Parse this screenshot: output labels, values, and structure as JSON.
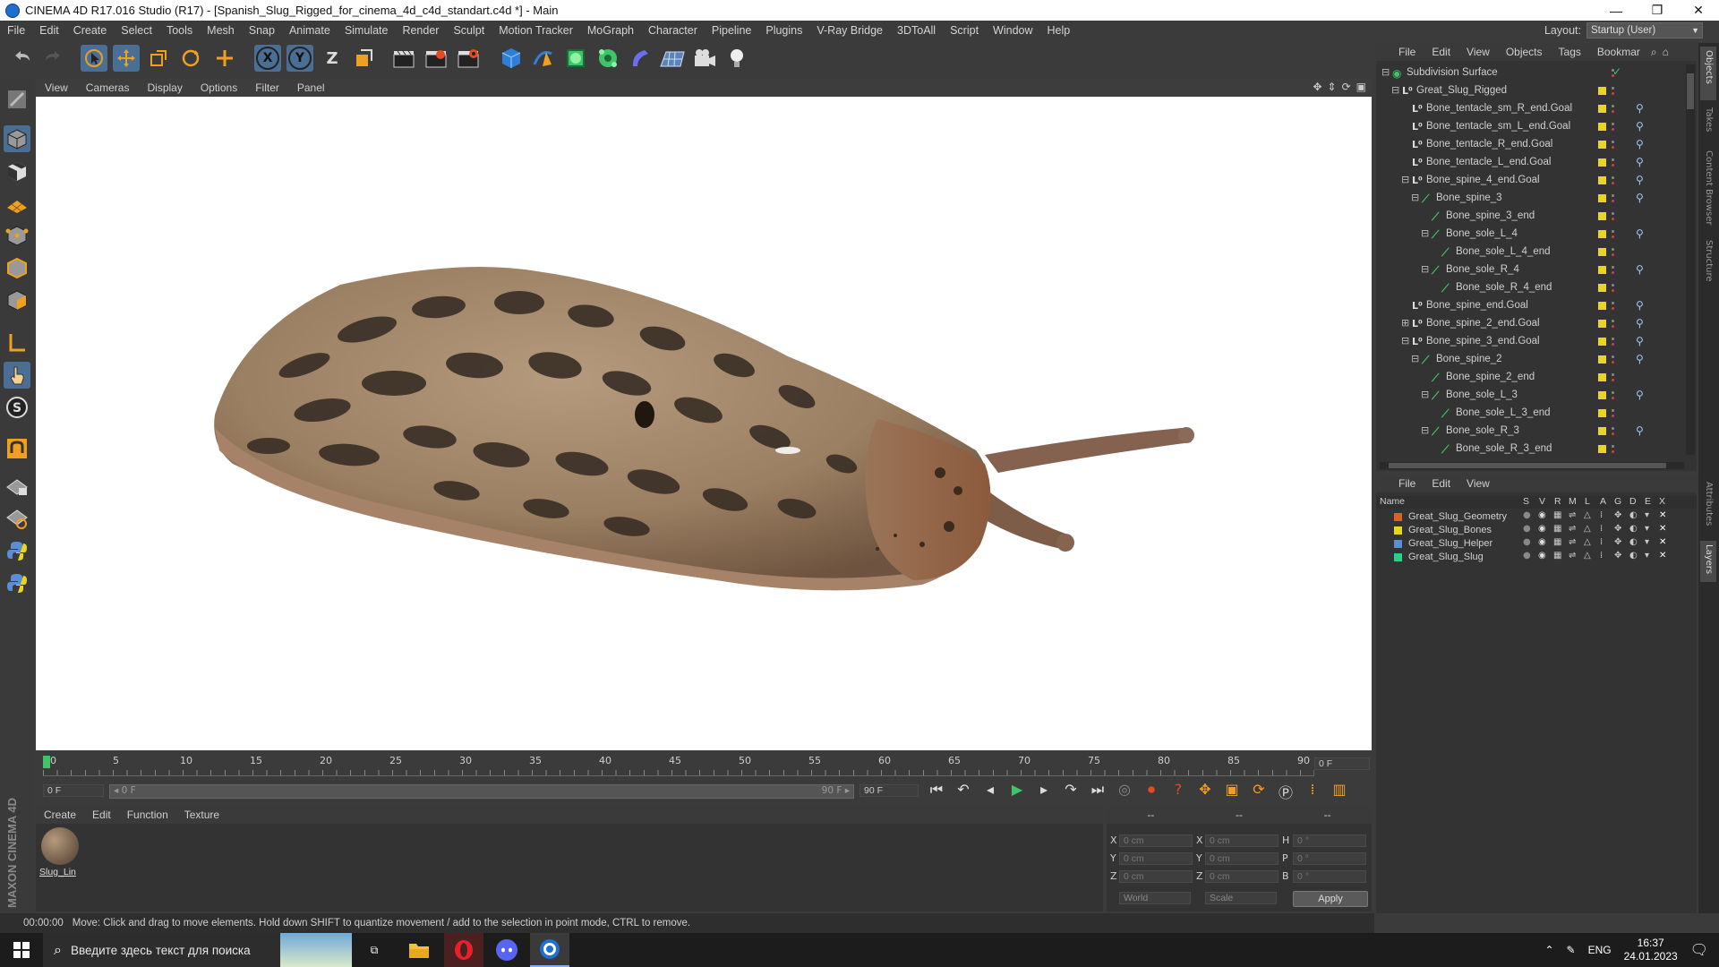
{
  "window": {
    "title": "CINEMA 4D R17.016 Studio (R17) - [Spanish_Slug_Rigged_for_cinema_4d_c4d_standart.c4d *] - Main",
    "minimize": "—",
    "maximize": "❐",
    "close": "✕"
  },
  "menu": {
    "items": [
      "File",
      "Edit",
      "Create",
      "Select",
      "Tools",
      "Mesh",
      "Snap",
      "Animate",
      "Simulate",
      "Render",
      "Sculpt",
      "Motion Tracker",
      "MoGraph",
      "Character",
      "Pipeline",
      "Plugins",
      "V-Ray Bridge",
      "3DToAll",
      "Script",
      "Window",
      "Help"
    ],
    "layout_label": "Layout:",
    "layout_value": "Startup (User)"
  },
  "toolbar": {
    "axis_x": "X",
    "axis_y": "Y",
    "axis_z": "Z"
  },
  "viewport": {
    "menu": [
      "View",
      "Cameras",
      "Display",
      "Options",
      "Filter",
      "Panel"
    ]
  },
  "timeline": {
    "ticks": [
      "0",
      "5",
      "10",
      "15",
      "20",
      "25",
      "30",
      "35",
      "40",
      "45",
      "50",
      "55",
      "60",
      "65",
      "70",
      "75",
      "80",
      "85",
      "90"
    ],
    "current_frame": "0 F"
  },
  "transport": {
    "start_field": "0 F",
    "slider_left": "◂ 0 F",
    "slider_right": "90 F ▸",
    "end_field": "90 F"
  },
  "material_manager": {
    "menu": [
      "Create",
      "Edit",
      "Function",
      "Texture"
    ],
    "material_name": "Slug_Lin"
  },
  "coordinates": {
    "header": [
      "--",
      "--",
      "--"
    ],
    "rows": [
      {
        "l1": "X",
        "v1": "0 cm",
        "l2": "X",
        "v2": "0 cm",
        "l3": "H",
        "v3": "0 °"
      },
      {
        "l1": "Y",
        "v1": "0 cm",
        "l2": "Y",
        "v2": "0 cm",
        "l3": "P",
        "v3": "0 °"
      },
      {
        "l1": "Z",
        "v1": "0 cm",
        "l2": "Z",
        "v2": "0 cm",
        "l3": "B",
        "v3": "0 °"
      }
    ],
    "mode": "World",
    "transform": "Scale",
    "apply": "Apply"
  },
  "status": {
    "time": "00:00:00",
    "message": "Move: Click and drag to move elements. Hold down SHIFT to quantize movement / add to the selection in point mode, CTRL to remove."
  },
  "object_manager": {
    "menu": [
      "File",
      "Edit",
      "View",
      "Objects",
      "Tags",
      "Bookmar"
    ],
    "items": [
      {
        "name": "Subdivision Surface",
        "indent": 0,
        "expand": "⊟",
        "kind": "subd",
        "tag": false
      },
      {
        "name": "Great_Slug_Rigged",
        "indent": 1,
        "expand": "⊟",
        "kind": "null",
        "tag": false
      },
      {
        "name": "Bone_tentacle_sm_R_end.Goal",
        "indent": 2,
        "expand": "",
        "kind": "null",
        "tag": true
      },
      {
        "name": "Bone_tentacle_sm_L_end.Goal",
        "indent": 2,
        "expand": "",
        "kind": "null",
        "tag": true
      },
      {
        "name": "Bone_tentacle_R_end.Goal",
        "indent": 2,
        "expand": "",
        "kind": "null",
        "tag": true
      },
      {
        "name": "Bone_tentacle_L_end.Goal",
        "indent": 2,
        "expand": "",
        "kind": "null",
        "tag": true
      },
      {
        "name": "Bone_spine_4_end.Goal",
        "indent": 2,
        "expand": "⊟",
        "kind": "null",
        "tag": true
      },
      {
        "name": "Bone_spine_3",
        "indent": 3,
        "expand": "⊟",
        "kind": "bone",
        "tag": true
      },
      {
        "name": "Bone_spine_3_end",
        "indent": 4,
        "expand": "",
        "kind": "bone",
        "tag": false
      },
      {
        "name": "Bone_sole_L_4",
        "indent": 4,
        "expand": "⊟",
        "kind": "bone",
        "tag": true
      },
      {
        "name": "Bone_sole_L_4_end",
        "indent": 5,
        "expand": "",
        "kind": "bone",
        "tag": false
      },
      {
        "name": "Bone_sole_R_4",
        "indent": 4,
        "expand": "⊟",
        "kind": "bone",
        "tag": true
      },
      {
        "name": "Bone_sole_R_4_end",
        "indent": 5,
        "expand": "",
        "kind": "bone",
        "tag": false
      },
      {
        "name": "Bone_spine_end.Goal",
        "indent": 2,
        "expand": "",
        "kind": "null",
        "tag": true
      },
      {
        "name": "Bone_spine_2_end.Goal",
        "indent": 2,
        "expand": "⊞",
        "kind": "null",
        "tag": true
      },
      {
        "name": "Bone_spine_3_end.Goal",
        "indent": 2,
        "expand": "⊟",
        "kind": "null",
        "tag": true
      },
      {
        "name": "Bone_spine_2",
        "indent": 3,
        "expand": "⊟",
        "kind": "bone",
        "tag": true
      },
      {
        "name": "Bone_spine_2_end",
        "indent": 4,
        "expand": "",
        "kind": "bone",
        "tag": false
      },
      {
        "name": "Bone_sole_L_3",
        "indent": 4,
        "expand": "⊟",
        "kind": "bone",
        "tag": true
      },
      {
        "name": "Bone_sole_L_3_end",
        "indent": 5,
        "expand": "",
        "kind": "bone",
        "tag": false
      },
      {
        "name": "Bone_sole_R_3",
        "indent": 4,
        "expand": "⊟",
        "kind": "bone",
        "tag": true
      },
      {
        "name": "Bone_sole_R_3_end",
        "indent": 5,
        "expand": "",
        "kind": "bone",
        "tag": false
      }
    ]
  },
  "layer_manager": {
    "menu": [
      "File",
      "Edit",
      "View"
    ],
    "columns": [
      "Name",
      "S",
      "V",
      "R",
      "M",
      "L",
      "A",
      "G",
      "D",
      "E",
      "X"
    ],
    "layers": [
      {
        "name": "Great_Slug_Geometry",
        "color": "#d8622a"
      },
      {
        "name": "Great_Slug_Bones",
        "color": "#e8d71e"
      },
      {
        "name": "Great_Slug_Helper",
        "color": "#5a8fd8"
      },
      {
        "name": "Great_Slug_Slug",
        "color": "#2ecf8a"
      }
    ]
  },
  "right_tabs": [
    "Objects",
    "Takes",
    "Content Browser",
    "Structure",
    "Attributes",
    "Layers"
  ],
  "taskbar": {
    "search_placeholder": "Введите здесь текст для поиска",
    "lang": "ENG",
    "time": "16:37",
    "date": "24.01.2023"
  },
  "brand": "MAXON CINEMA 4D",
  "colors": {
    "accent_blue": "#2f7fd8",
    "bone_green": "#3fc46a",
    "layer_yellow": "#e8d71e"
  }
}
